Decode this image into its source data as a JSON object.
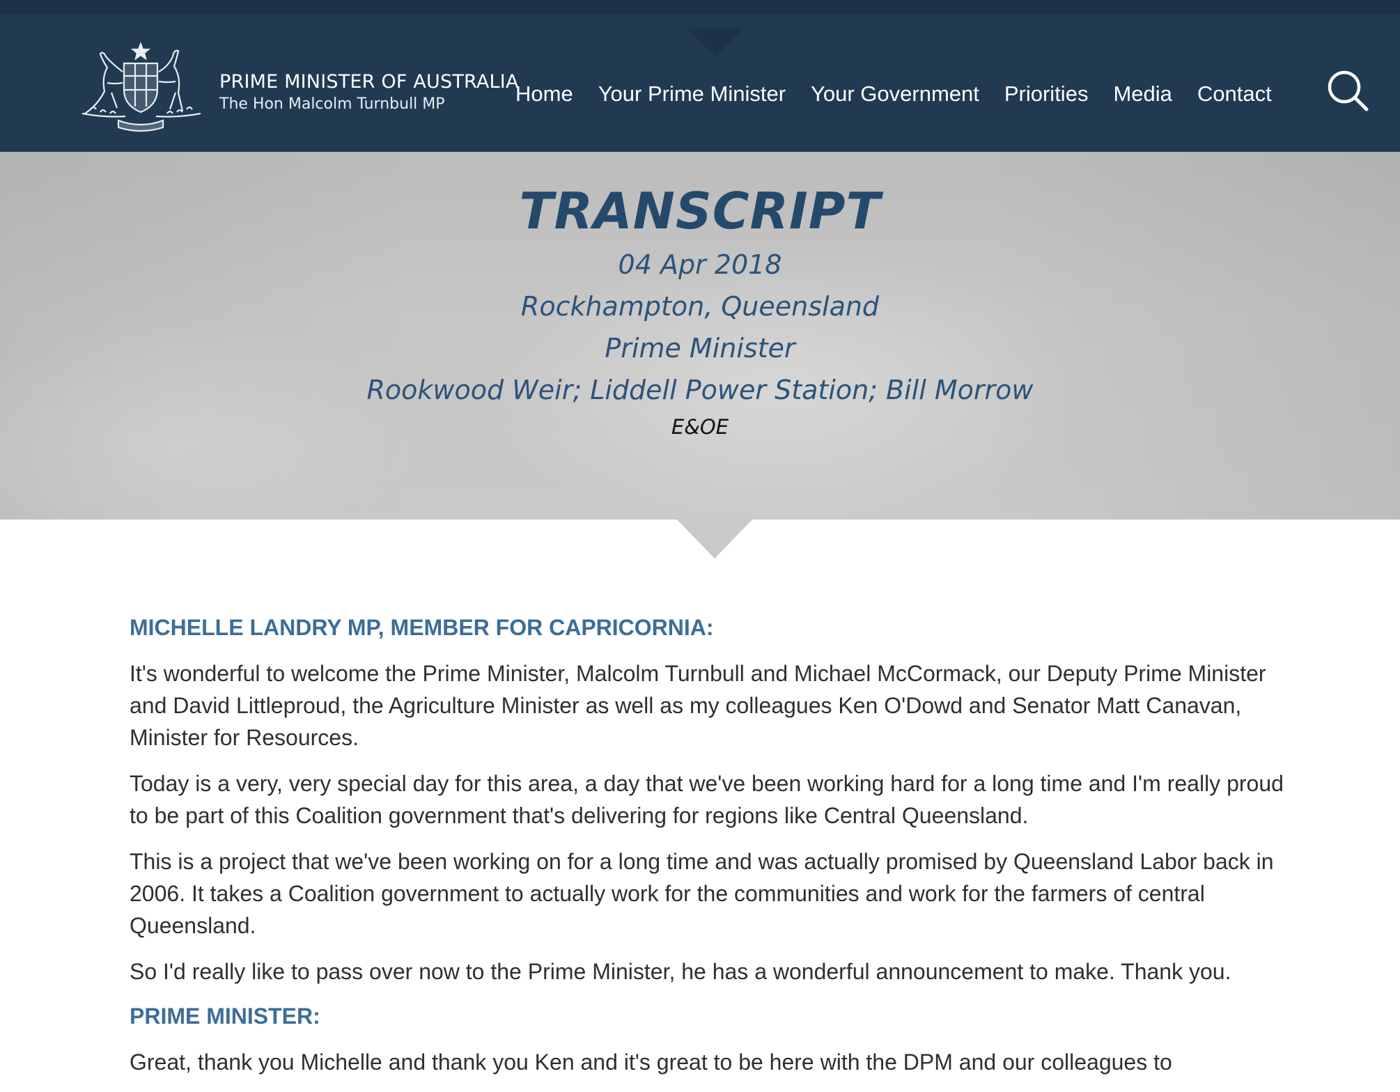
{
  "header": {
    "brand_title": "PRIME MINISTER OF AUSTRALIA",
    "brand_subtitle": "The Hon Malcolm Turnbull MP",
    "nav": [
      {
        "label": "Home"
      },
      {
        "label": "Your Prime Minister"
      },
      {
        "label": "Your Government"
      },
      {
        "label": "Priorities"
      },
      {
        "label": "Media"
      },
      {
        "label": "Contact"
      }
    ],
    "search_icon": "search-icon"
  },
  "hero": {
    "title": "TRANSCRIPT",
    "date": "04 Apr 2018",
    "location": "Rockhampton, Queensland",
    "speaker": "Prime Minister",
    "topics": "Rookwood Weir; Liddell Power Station; Bill Morrow",
    "eoe": "E&OE"
  },
  "article": {
    "speaker_1": "MICHELLE LANDRY MP, MEMBER FOR CAPRICORNIA:",
    "paragraphs_1": [
      "It's wonderful to welcome the Prime Minister, Malcolm Turnbull and Michael McCormack, our Deputy Prime Minister and David Littleproud, the Agriculture Minister as well as my colleagues Ken O'Dowd and Senator Matt Canavan, Minister for Resources.",
      "Today is a very, very special day for this area, a day that we've been working hard for a long time and I'm really proud to be part of this Coalition government that's delivering for regions like Central Queensland.",
      "This is a project that we've been working on for a long time and was actually promised by Queensland Labor back in 2006. It takes a Coalition government to actually work for the communities and work for the farmers of central Queensland.",
      "So I'd really like to pass over now to the Prime Minister, he has a wonderful announcement to make. Thank you."
    ],
    "speaker_2": "PRIME MINISTER:",
    "paragraphs_2": [
      "Great, thank you Michelle and thank you Ken and it's great to be here with the DPM and our colleagues to"
    ]
  }
}
